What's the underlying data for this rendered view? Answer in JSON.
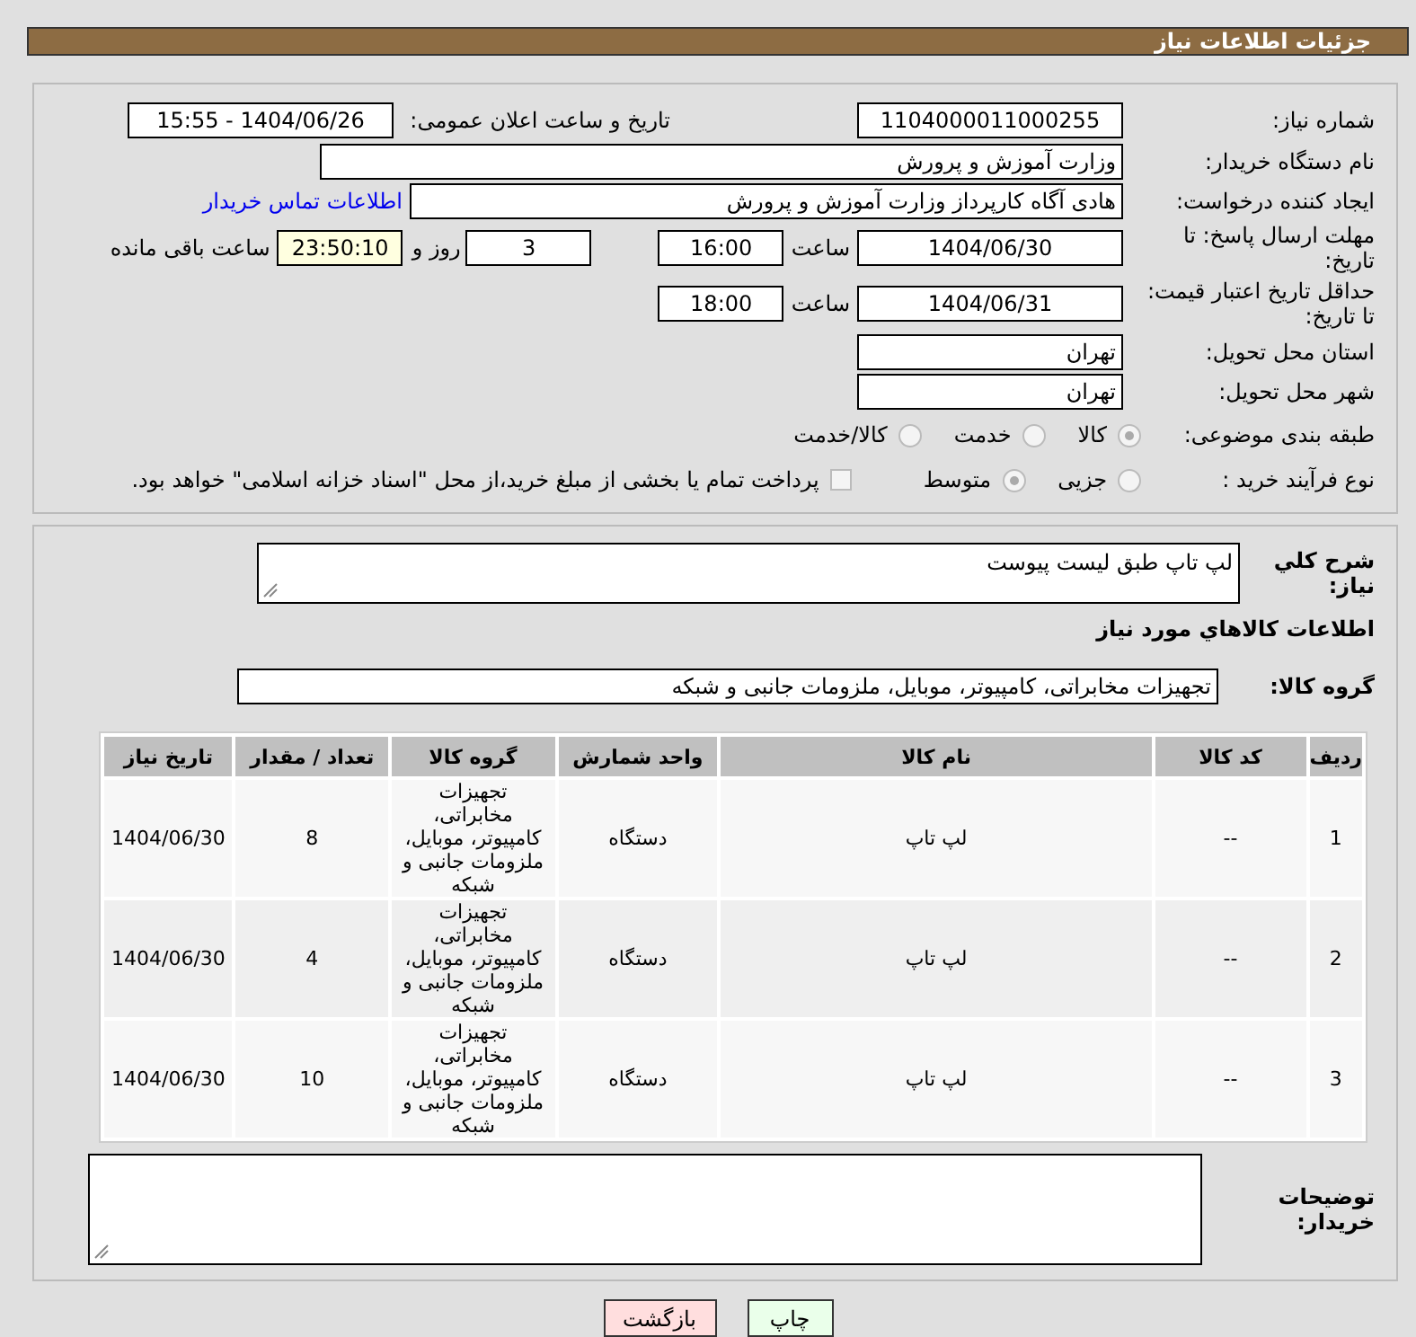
{
  "header": {
    "title": "جزئیات اطلاعات نیاز"
  },
  "need_number": {
    "label": "شماره نیاز:",
    "value": "1104000011000255"
  },
  "announce": {
    "label": "تاریخ و ساعت اعلان عمومی:",
    "value": "1404/06/26 - 15:55"
  },
  "buyer_org": {
    "label": "نام دستگاه خریدار:",
    "value": "وزارت آموزش و پرورش"
  },
  "creator": {
    "label": "ایجاد کننده درخواست:",
    "value": "هادی آگاه کارپرداز وزارت آموزش و پرورش",
    "link": "اطلاعات تماس خریدار"
  },
  "reply_deadline": {
    "label": "مهلت ارسال پاسخ: تا تاریخ:",
    "date": "1404/06/30",
    "time_label": "ساعت",
    "time": "16:00",
    "days": "3",
    "days_label": "روز و",
    "remaining": "23:50:10",
    "remaining_label": "ساعت باقی مانده"
  },
  "price_validity": {
    "label": "حداقل تاریخ اعتبار قیمت: تا تاریخ:",
    "date": "1404/06/31",
    "time_label": "ساعت",
    "time": "18:00"
  },
  "province": {
    "label": "استان محل تحویل:",
    "value": "تهران"
  },
  "city": {
    "label": "شهر محل تحویل:",
    "value": "تهران"
  },
  "category": {
    "label": "طبقه بندی موضوعی:",
    "options": [
      {
        "label": "کالا",
        "selected": true
      },
      {
        "label": "خدمت",
        "selected": false
      },
      {
        "label": "کالا/خدمت",
        "selected": false
      }
    ]
  },
  "process": {
    "label": "نوع فرآیند خرید :",
    "options": [
      {
        "label": "جزیی",
        "selected": false
      },
      {
        "label": "متوسط",
        "selected": true
      }
    ],
    "treasury": {
      "label": "پرداخت تمام یا بخشی از مبلغ خرید،از محل \"اسناد خزانه اسلامی\" خواهد بود.",
      "checked": false
    }
  },
  "description": {
    "label": "شرح کلي نياز:",
    "value": "لپ تاپ طبق لیست پیوست"
  },
  "goods_heading": "اطلاعات کالاهاي مورد نياز",
  "goods_group": {
    "label": "گروه کالا:",
    "value": "تجهیزات مخابراتی، کامپیوتر، موبایل، ملزومات جانبی و شبکه"
  },
  "table": {
    "columns": [
      "ردیف",
      "کد کالا",
      "نام کالا",
      "واحد شمارش",
      "گروه کالا",
      "تعداد / مقدار",
      "تاریخ نیاز"
    ],
    "rows": [
      [
        "1",
        "--",
        "لپ تاپ",
        "دستگاه",
        "تجهیزات مخابراتی، کامپیوتر، موبایل، ملزومات جانبی و شبکه",
        "8",
        "1404/06/30"
      ],
      [
        "2",
        "--",
        "لپ تاپ",
        "دستگاه",
        "تجهیزات مخابراتی، کامپیوتر، موبایل، ملزومات جانبی و شبکه",
        "4",
        "1404/06/30"
      ],
      [
        "3",
        "--",
        "لپ تاپ",
        "دستگاه",
        "تجهیزات مخابراتی، کامپیوتر، موبایل، ملزومات جانبی و شبکه",
        "10",
        "1404/06/30"
      ]
    ]
  },
  "buyer_notes": {
    "label": "توضیحات خریدار:"
  },
  "buttons": [
    {
      "label": "چاپ",
      "kind": "print"
    },
    {
      "label": "بازگشت",
      "kind": "back"
    }
  ]
}
